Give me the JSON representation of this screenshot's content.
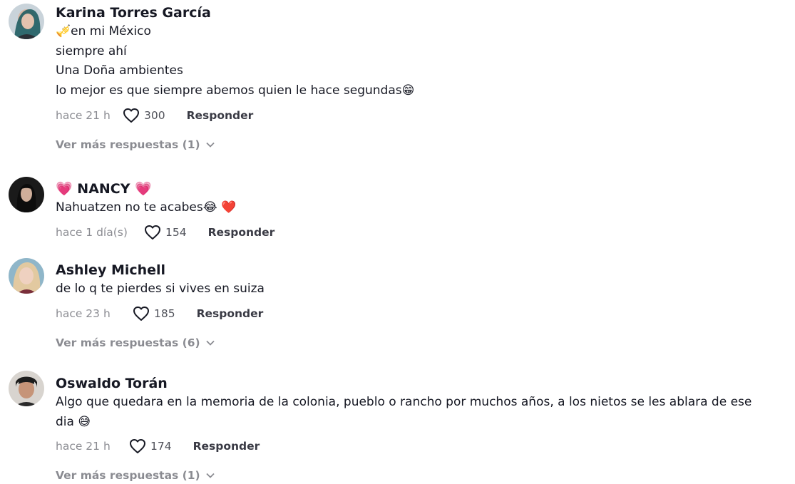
{
  "comments": [
    {
      "username": "Karina Torres García",
      "lines": [
        "🎺en mi México",
        "siempre ahí",
        "Una Doña ambientes",
        "lo mejor es que siempre abemos quien le hace segundas😁"
      ],
      "time": "hace 21 h",
      "likes": "300",
      "reply_label": "Responder",
      "more_replies": "Ver más respuestas (1)"
    },
    {
      "username_prefix": "💗",
      "username": "NANCY",
      "username_suffix": "💗",
      "lines": [
        "Nahuatzen no te acabes😂 ❤️"
      ],
      "time": "hace 1 día(s)",
      "likes": "154",
      "reply_label": "Responder"
    },
    {
      "username": "Ashley Michell",
      "lines": [
        "de lo q te pierdes si vives en suiza"
      ],
      "time": "hace 23 h",
      "likes": "185",
      "reply_label": "Responder",
      "more_replies": "Ver más respuestas (6)"
    },
    {
      "username": "Oswaldo Torán",
      "lines": [
        "Algo que quedara en la memoria de la colonia, pueblo o rancho por muchos años, a los nietos se les ablara de ese",
        "dia 😅"
      ],
      "time": "hace 21 h",
      "likes": "174",
      "reply_label": "Responder",
      "more_replies": "Ver más respuestas (1)"
    }
  ],
  "icons": {
    "like": "heart-outline-icon",
    "expand": "chevron-down-icon"
  },
  "colors": {
    "text_primary": "#161823",
    "text_secondary": "#8a8b91",
    "heart_red": "#e0202c",
    "heart_pink": "#ff3b8d"
  }
}
